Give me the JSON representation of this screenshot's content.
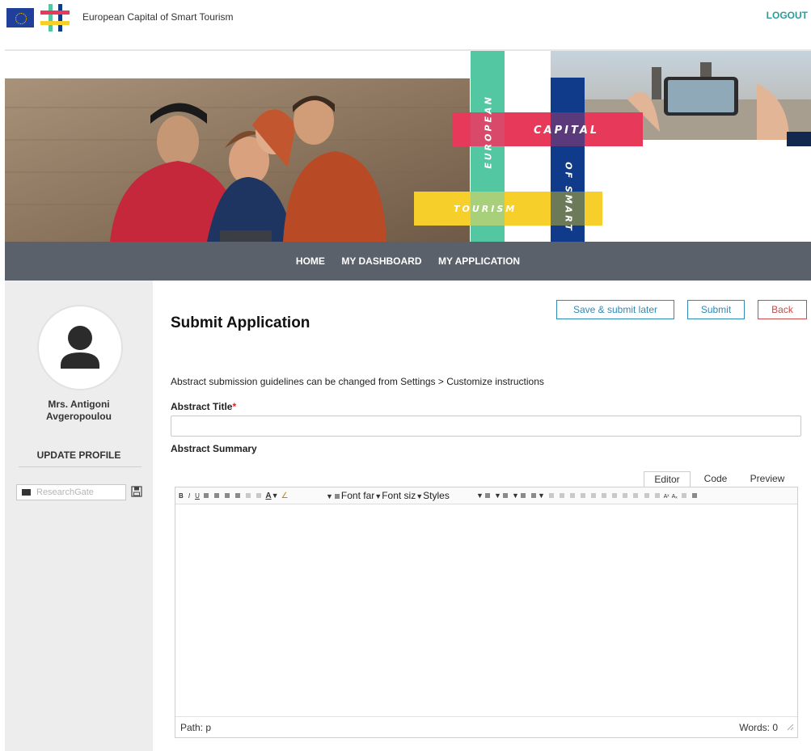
{
  "header": {
    "site_title": "European Capital of Smart Tourism",
    "logout_label": "LOGOUT"
  },
  "hero": {
    "words": [
      "EUROPEAN",
      "CAPITAL",
      "OF SMART",
      "TOURISM"
    ],
    "colors": {
      "teal": "#52c7a2",
      "pink": "#e73a5a",
      "navy": "#103b8a",
      "yellow": "#f6cf2a"
    }
  },
  "nav": {
    "items": [
      "HOME",
      "MY DASHBOARD",
      "MY APPLICATION"
    ]
  },
  "sidebar": {
    "name_line1": "Mrs. Antigoni",
    "name_line2": "Avgeropoulou",
    "update_profile": "UPDATE PROFILE",
    "researchgate_placeholder": "ResearchGate"
  },
  "main": {
    "title": "Submit Application",
    "buttons": {
      "save_later": "Save & submit later",
      "submit": "Submit",
      "back": "Back"
    },
    "guidelines": "Abstract submission guidelines can be changed from Settings > Customize instructions",
    "abstract_title_label": "Abstract Title",
    "required_mark": "*",
    "abstract_title_value": "",
    "abstract_summary_label": "Abstract Summary"
  },
  "editor": {
    "tabs": [
      "Editor",
      "Code",
      "Preview"
    ],
    "font_family": "Font far",
    "font_size": "Font siz",
    "styles": "Styles",
    "path": "Path: p",
    "words": "Words: 0"
  },
  "colors": {
    "nav_bg": "#5a616a",
    "sidebar_bg": "#ededed",
    "accent_blue": "#2e8ab7",
    "back_red": "#c94a4a",
    "logout_teal": "#2a9c9c"
  }
}
